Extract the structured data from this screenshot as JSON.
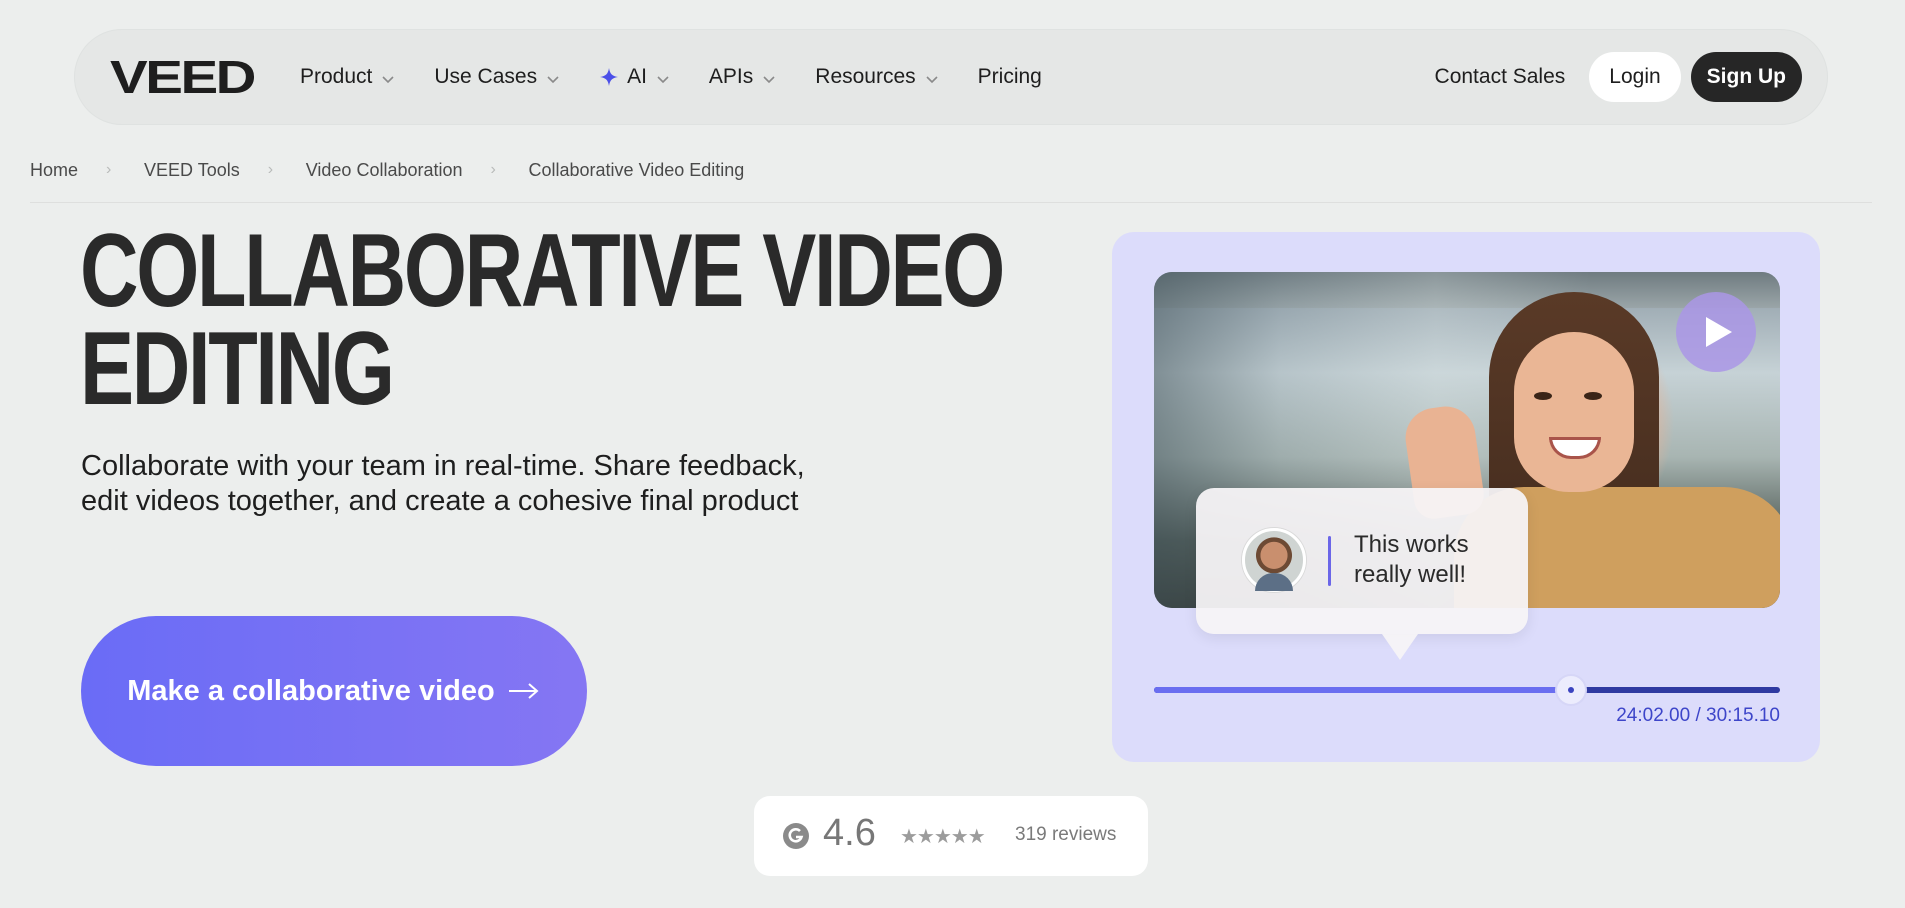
{
  "nav": {
    "logo_text": "VEED",
    "items": [
      {
        "label": "Product",
        "has_dropdown": true
      },
      {
        "label": "Use Cases",
        "has_dropdown": true
      },
      {
        "label": "AI",
        "has_dropdown": true,
        "icon": "sparkle-icon"
      },
      {
        "label": "APIs",
        "has_dropdown": true
      },
      {
        "label": "Resources",
        "has_dropdown": true
      },
      {
        "label": "Pricing",
        "has_dropdown": false
      }
    ],
    "contact_sales": "Contact Sales",
    "login": "Login",
    "signup": "Sign Up"
  },
  "breadcrumb": [
    "Home",
    "VEED Tools",
    "Video Collaboration",
    "Collaborative Video Editing"
  ],
  "hero": {
    "title_line1": "COLLABORATIVE VIDEO",
    "title_line2": "EDITING",
    "subtitle": "Collaborate with your team in real-time. Share feedback, edit videos together, and create a cohesive final product",
    "cta_label": "Make a collaborative video"
  },
  "video_card": {
    "comment_text": "This works really well!",
    "progress": 0.666,
    "timecode": "24:02.00 / 30:15.10"
  },
  "rating": {
    "score": "4.6",
    "stars": "★★★★★",
    "reviews": "319 reviews"
  },
  "colors": {
    "accent": "#6a6cf6",
    "card_bg": "#dcdcfb",
    "timecode": "#3d45c9",
    "signup_bg": "#262626"
  }
}
